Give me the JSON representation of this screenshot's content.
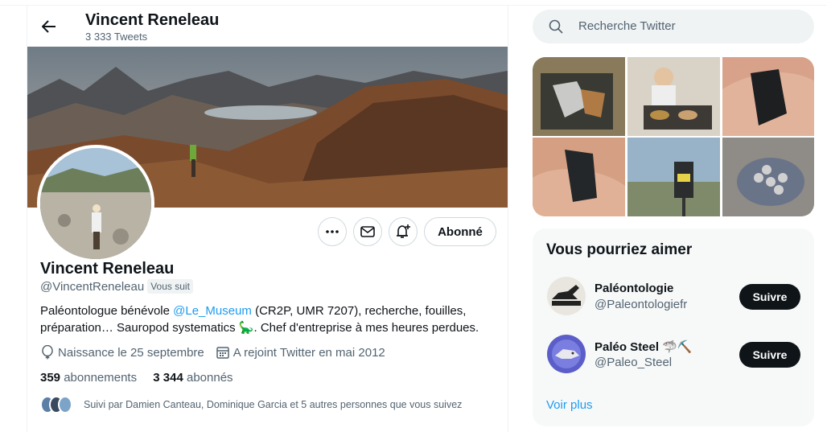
{
  "header": {
    "name": "Vincent Reneleau",
    "tweet_count": "3 333 Tweets"
  },
  "profile": {
    "name": "Vincent Reneleau",
    "handle": "@VincentReneleau",
    "follows_you": "Vous suit",
    "bio_part1": "Paléontologue bénévole ",
    "bio_link": "@Le_Museum",
    "bio_part2": " (CR2P, UMR 7207), recherche, fouilles, préparation… Sauropod systematics ",
    "bio_emoji": "🦕",
    "bio_part3": ". Chef d'entreprise à mes heures perdues.",
    "birthday": "Naissance le 25 septembre",
    "joined": "A rejoint Twitter en mai 2012",
    "following_count": "359",
    "following_label": "abonnements",
    "followers_count": "3 344",
    "followers_label": "abonnés",
    "followed_by": "Suivi par Damien Canteau, Dominique Garcia et 5 autres personnes que vous suivez",
    "subscribed_label": "Abonné"
  },
  "search": {
    "placeholder": "Recherche Twitter"
  },
  "suggestions": {
    "title": "Vous pourriez aimer",
    "items": [
      {
        "name": "Paléontologie",
        "handle": "@Paleontologiefr",
        "button": "Suivre"
      },
      {
        "name": "Paléo Steel 🦈⛏️",
        "handle": "@Paleo_Steel",
        "button": "Suivre"
      }
    ],
    "more": "Voir plus"
  },
  "colors": {
    "accent": "#1d9bf0",
    "dark_button": "#0f1419",
    "muted": "#536471"
  }
}
